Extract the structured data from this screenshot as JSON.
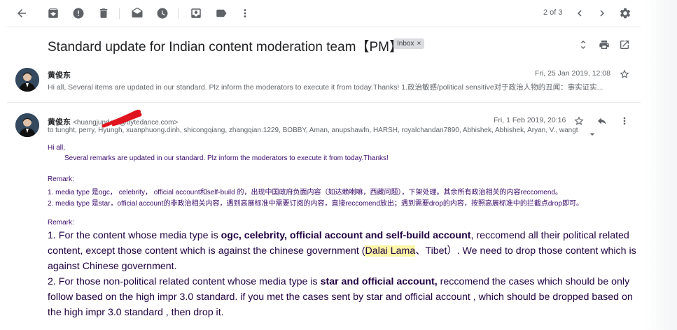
{
  "toolbar": {
    "pager": "2 of 3",
    "icons": [
      "back-arrow-icon",
      "archive-icon",
      "report-spam-icon",
      "delete-icon",
      "mark-unread-icon",
      "snooze-icon",
      "move-to-icon",
      "label-icon",
      "more-vert-icon",
      "chevron-left-icon",
      "chevron-right-icon",
      "settings-icon"
    ]
  },
  "thread": {
    "subject": "Standard update for Indian content moderation team【PM】",
    "label": "Inbox",
    "label_close": "×"
  },
  "message1": {
    "sender": "黄俊东",
    "date": "Fri, 25 Jan 2019, 12:08",
    "snippet": "Hi all, Several items are updated in our standard. Plz inform the moderators to execute it from today.Thanks! 1.政治敏感/political sensitive对于政治人物的丑闻：事实证实..."
  },
  "message2": {
    "sender": "黄俊东",
    "email": "<huangjunde   3@bytedance.com>",
    "date": "Fri, 1 Feb 2019, 20:16",
    "to": "to tunght, perry, Hyungh, xuanphuong.dinh, shicongqiang, zhangqian.1229, BOBBY, Aman, anupshawfn, HARSH, royalchandan7890, Abhishek, Abhishek, Aryan, V., wangt",
    "greeting": "Hi all,",
    "intro": "Several remarks are updated in our standard. Plz inform the moderators to execute it from today.Thanks!",
    "remark_cn_title": "Remark:",
    "remark_cn_1": "1. media type 是ogc， celebrity， official account和self-build 的，出现中国政府负面内容（如达赖喇嘛，西藏问题），下架处理。其余所有政治相关的内容reccomend。",
    "remark_cn_2": "2. media type 是star，official account的非政治相关内容，遇到高展标准中需要订阅的内容，直接reccomend放出；遇到需要drop的内容，按照高展标准中的拦截点drop即可。",
    "remark_en_title": "Remark:",
    "p1_a": "1. For the content whose media type is ",
    "p1_bold": "ogc, celebrity, official account and self-build account",
    "p1_b": ", reccomend all their political related content, except those content which is against the chinese government (",
    "p1_hl": "Dalai Lama",
    "p1_c": "、Tibet）. We need to drop those content which is against Chinese government.",
    "p2_a": "2. For those non-political related content whose media type is ",
    "p2_bold": "star and official account,",
    "p2_b": " reccomend the cases which should be only follow based on the high impr 3.0 standard. if you met the cases sent by star and official account , which should be dropped based on the high impr 3.0 standard , then drop it."
  }
}
